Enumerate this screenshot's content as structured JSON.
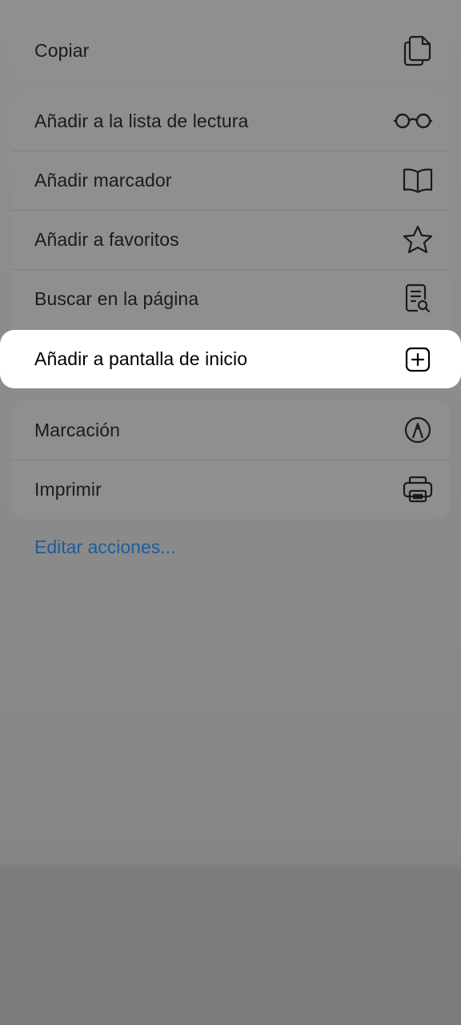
{
  "group_one": {
    "items": [
      {
        "label": "Copiar",
        "icon": "copy-icon"
      }
    ]
  },
  "group_two": {
    "items": [
      {
        "label": "Añadir a la lista de lectura",
        "icon": "glasses-icon"
      },
      {
        "label": "Añadir marcador",
        "icon": "book-icon"
      },
      {
        "label": "Añadir a favoritos",
        "icon": "star-icon"
      },
      {
        "label": "Buscar en la página",
        "icon": "find-in-page-icon"
      }
    ]
  },
  "highlighted_item": {
    "label": "Añadir a pantalla de inicio",
    "icon": "add-square-icon"
  },
  "group_three": {
    "items": [
      {
        "label": "Marcación",
        "icon": "markup-pen-icon"
      },
      {
        "label": "Imprimir",
        "icon": "printer-icon"
      }
    ]
  },
  "edit_actions": {
    "label": "Editar acciones..."
  },
  "colors": {
    "link": "#1f5c9a",
    "dim_background": "#8a8a8a",
    "highlight_background": "#ffffff"
  }
}
